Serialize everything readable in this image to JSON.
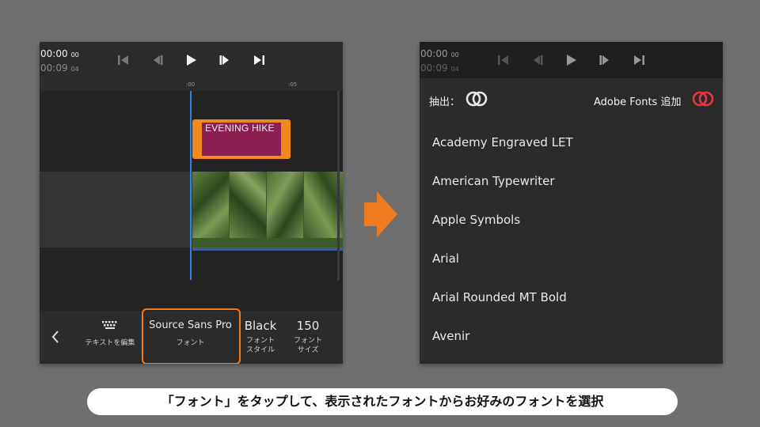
{
  "left_panel": {
    "timecode_current": "00:00",
    "timecode_current_frames": "00",
    "timecode_total": "00:09",
    "timecode_total_frames": "04",
    "ruler_start": ":00",
    "ruler_mark": ":05",
    "title_clip_text": "EVENING HIKE",
    "toolbar": {
      "edit_text_label": "テキストを編集",
      "font_value": "Source Sans Pro",
      "font_label": "フォント",
      "style_value": "Black",
      "style_label_1": "フォント",
      "style_label_2": "スタイル",
      "size_value": "150",
      "size_label_1": "フォント",
      "size_label_2": "サイズ"
    }
  },
  "right_panel": {
    "timecode_current": "00:00",
    "timecode_current_frames": "00",
    "timecode_total": "00:09",
    "timecode_total_frames": "04",
    "extract_label": "抽出：",
    "adobe_fonts_label": "Adobe Fonts 追加",
    "fonts": [
      "Academy Engraved LET",
      "American Typewriter",
      "Apple Symbols",
      "Arial",
      "Arial Rounded MT Bold",
      "Avenir"
    ]
  },
  "caption": "「フォント」をタップして、表示されたフォントからお好みのフォントを選択",
  "colors": {
    "accent_orange": "#f07a1e",
    "playhead_blue": "#2f83e0",
    "title_clip": "#8b1f52",
    "cc_red": "#e8353f"
  }
}
